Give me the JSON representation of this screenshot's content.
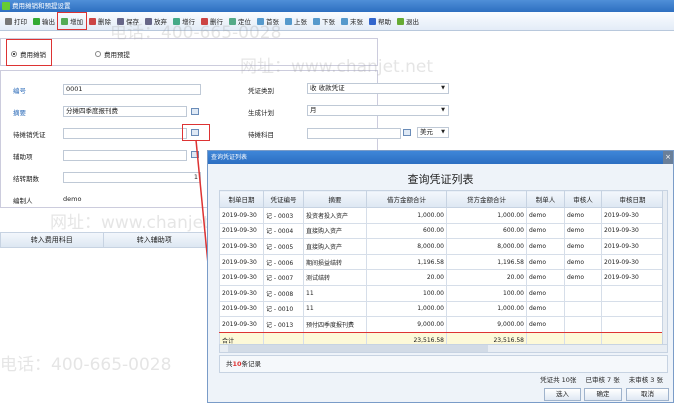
{
  "window": {
    "title": "费用摊销和预提设置"
  },
  "toolbar": [
    {
      "label": "打印",
      "icon": "printer-icon"
    },
    {
      "label": "输出",
      "icon": "export-icon"
    },
    {
      "label": "增加",
      "icon": "add-icon",
      "highlighted": true
    },
    {
      "label": "删除",
      "icon": "delete-icon"
    },
    {
      "label": "保存",
      "icon": "save-icon"
    },
    {
      "label": "放弃",
      "icon": "discard-icon"
    },
    {
      "label": "增行",
      "icon": "add-row-icon"
    },
    {
      "label": "删行",
      "icon": "delete-row-icon"
    },
    {
      "label": "定位",
      "icon": "locate-icon"
    },
    {
      "label": "首张",
      "icon": "first-icon"
    },
    {
      "label": "上张",
      "icon": "prev-icon"
    },
    {
      "label": "下张",
      "icon": "next-icon"
    },
    {
      "label": "末张",
      "icon": "last-icon"
    },
    {
      "label": "帮助",
      "icon": "help-icon"
    },
    {
      "label": "退出",
      "icon": "exit-icon"
    }
  ],
  "mode": {
    "option1": "费用摊销",
    "option2": "费用预提",
    "selected": "费用摊销"
  },
  "form": {
    "code_label": "编号",
    "code_value": "0001",
    "summary_label": "摘要",
    "summary_value": "分摊四季度报刊费",
    "pending_voucher_label": "待摊销凭证",
    "pending_voucher_value": "",
    "aux_label": "辅助项",
    "aux_value": "",
    "periods_label": "结转期数",
    "periods_value": "1",
    "maker_label": "编制人",
    "maker_value": "demo",
    "voucher_type_label": "凭证类别",
    "voucher_type_value": "收 收款凭证",
    "plan_label": "生成计划",
    "plan_value": "月",
    "pending_account_label": "待摊科目",
    "pending_account_value": "",
    "currency_value": "美元"
  },
  "transfer_table": {
    "headers": [
      "转入费用科目",
      "转入辅助项"
    ]
  },
  "dialog": {
    "title": "查询凭证列表",
    "heading": "查询凭证列表",
    "close": "×",
    "columns": [
      "制单日期",
      "凭证编号",
      "摘要",
      "借方金额合计",
      "贷方金额合计",
      "制单人",
      "审核人",
      "审核日期"
    ],
    "rows": [
      [
        "2019-09-30",
        "记 - 0003",
        "投资者投入资产",
        "1,000.00",
        "1,000.00",
        "demo",
        "demo",
        "2019-09-30"
      ],
      [
        "2019-09-30",
        "记 - 0004",
        "直接购入资产",
        "600.00",
        "600.00",
        "demo",
        "demo",
        "2019-09-30"
      ],
      [
        "2019-09-30",
        "记 - 0005",
        "直接购入资产",
        "8,000.00",
        "8,000.00",
        "demo",
        "demo",
        "2019-09-30"
      ],
      [
        "2019-09-30",
        "记 - 0006",
        "期间损益结转",
        "1,196.58",
        "1,196.58",
        "demo",
        "demo",
        "2019-09-30"
      ],
      [
        "2019-09-30",
        "记 - 0007",
        "测试结转",
        "20.00",
        "20.00",
        "demo",
        "demo",
        "2019-09-30"
      ],
      [
        "2019-09-30",
        "记 - 0008",
        "11",
        "100.00",
        "100.00",
        "demo",
        "",
        ""
      ],
      [
        "2019-09-30",
        "记 - 0010",
        "11",
        "1,000.00",
        "1,000.00",
        "demo",
        "",
        ""
      ],
      [
        "2019-09-30",
        "记 - 0013",
        "预付四季度报刊费",
        "9,000.00",
        "9,000.00",
        "demo",
        "",
        ""
      ]
    ],
    "selected_row": 7,
    "total": {
      "label": "合计",
      "debit": "23,516.58",
      "credit": "23,516.58"
    },
    "footer": {
      "records_prefix": "共",
      "records_count": "10",
      "records_suffix": "条记录",
      "voucher_total": "凭证共 10张",
      "audited": "已审核 7 张",
      "unaudited": "未审核 3 张"
    },
    "buttons": {
      "select": "选入",
      "ok": "确定",
      "cancel": "取消"
    }
  },
  "watermark": {
    "phone": "电话：400-665-0028",
    "site": "网址：www.chanjet.net"
  },
  "colors": {
    "accent": "#2b6ec2",
    "highlight": "#dd3333",
    "total_row": "#fdf9d8"
  }
}
